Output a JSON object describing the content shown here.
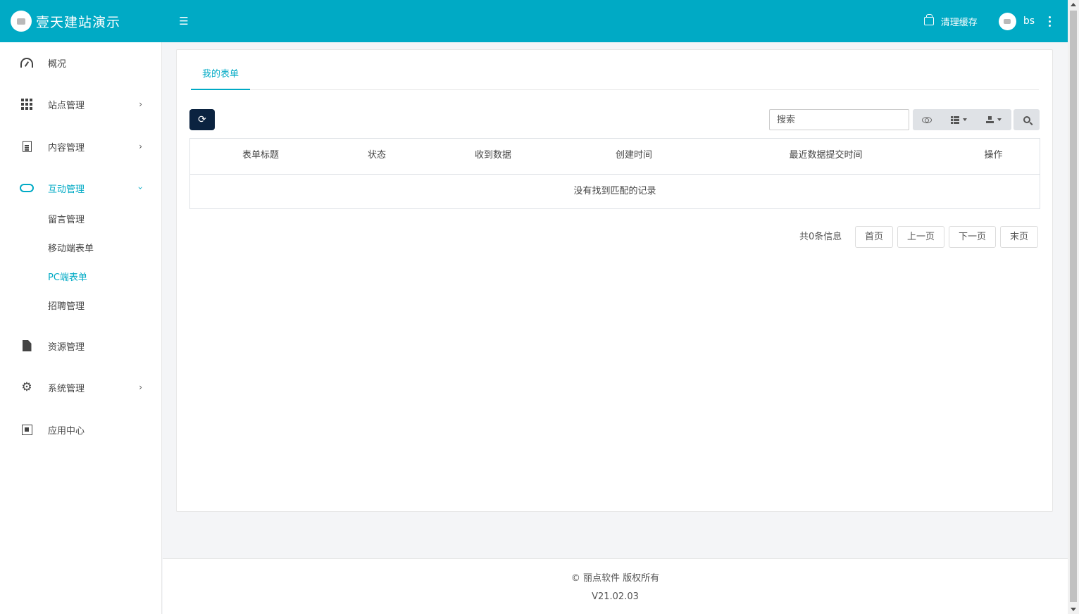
{
  "header": {
    "brand_title": "壹天建站演示",
    "clear_cache_label": "清理缓存",
    "user_name": "bs",
    "accent_color": "#00aac5"
  },
  "sidebar": {
    "items": [
      {
        "label": "概况",
        "icon": "dashboard-gauge-icon"
      },
      {
        "label": "站点管理",
        "icon": "grid-icon"
      },
      {
        "label": "内容管理",
        "icon": "document-icon"
      },
      {
        "label": "互动管理",
        "icon": "handshake-icon"
      },
      {
        "label": "资源管理",
        "icon": "file-icon"
      },
      {
        "label": "系统管理",
        "icon": "gear-icon"
      },
      {
        "label": "应用中心",
        "icon": "cube-icon"
      }
    ],
    "subitems": [
      {
        "label": "留言管理"
      },
      {
        "label": "移动端表单"
      },
      {
        "label": "PC端表单"
      },
      {
        "label": "招聘管理"
      }
    ]
  },
  "main": {
    "tab_label": "我的表单",
    "search_placeholder": "搜索",
    "table": {
      "columns": [
        "表单标题",
        "状态",
        "收到数据",
        "创建时间",
        "最近数据提交时间",
        "操作"
      ],
      "empty_text": "没有找到匹配的记录"
    },
    "pagination": {
      "info": "共0条信息",
      "first": "首页",
      "prev": "上一页",
      "next": "下一页",
      "last": "末页"
    }
  },
  "footer": {
    "copyright": "© 丽点软件 版权所有",
    "version": "V21.02.03"
  }
}
